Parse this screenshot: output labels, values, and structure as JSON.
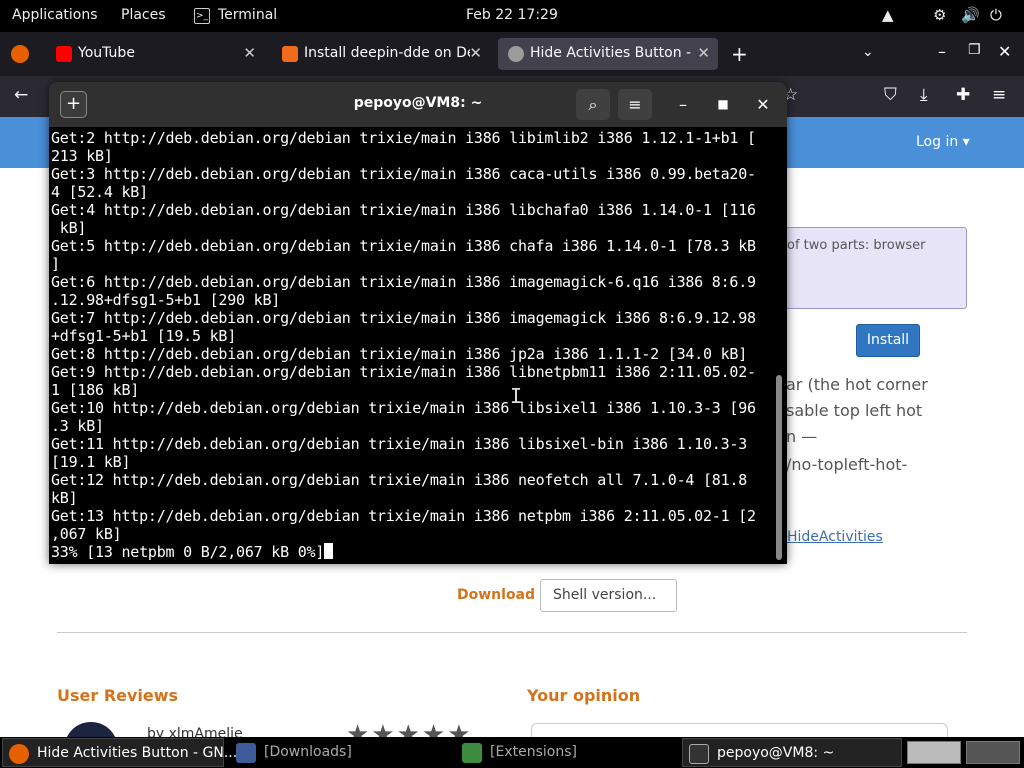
{
  "topbar": {
    "applications": "Applications",
    "places": "Places",
    "terminal": "Terminal",
    "clock": "Feb 22  17:29",
    "tray_icons": [
      "notification-icon",
      "network-icon",
      "volume-icon",
      "power-icon"
    ]
  },
  "browser": {
    "tabs": [
      {
        "label": "YouTube",
        "icon": "youtube-icon",
        "color": "#ff0000"
      },
      {
        "label": "Install deepin-dde on Deb",
        "icon": "ask-icon",
        "color": "#f26b1d"
      },
      {
        "label": "Hide Activities Button - G",
        "icon": "extension-icon",
        "color": "#9b9b9b"
      }
    ],
    "new_tab": "+"
  },
  "page": {
    "login": "Log in ▾",
    "notice": "of two parts: browser",
    "install": "Install",
    "desc_lines": [
      "ar (the hot corner",
      "sable top left hot",
      "n —",
      "/no-topleft-hot-"
    ],
    "ext_link": "HideActivities",
    "download": "Download",
    "shell_select": "Shell version...",
    "reviews_heading": "User Reviews",
    "opinion_heading": "Your opinion",
    "review_by": "by xlmAmelie",
    "stars": "★★★★★"
  },
  "terminal": {
    "title": "pepoyo@VM8: ~",
    "lines": [
      "Get:2 http://deb.debian.org/debian trixie/main i386 libimlib2 i386 1.12.1-1+b1 [",
      "213 kB]",
      "Get:3 http://deb.debian.org/debian trixie/main i386 caca-utils i386 0.99.beta20-",
      "4 [52.4 kB]",
      "Get:4 http://deb.debian.org/debian trixie/main i386 libchafa0 i386 1.14.0-1 [116",
      " kB]",
      "Get:5 http://deb.debian.org/debian trixie/main i386 chafa i386 1.14.0-1 [78.3 kB",
      "]",
      "Get:6 http://deb.debian.org/debian trixie/main i386 imagemagick-6.q16 i386 8:6.9",
      ".12.98+dfsg1-5+b1 [290 kB]",
      "Get:7 http://deb.debian.org/debian trixie/main i386 imagemagick i386 8:6.9.12.98",
      "+dfsg1-5+b1 [19.5 kB]",
      "Get:8 http://deb.debian.org/debian trixie/main i386 jp2a i386 1.1.1-2 [34.0 kB]",
      "Get:9 http://deb.debian.org/debian trixie/main i386 libnetpbm11 i386 2:11.05.02-",
      "1 [186 kB]",
      "Get:10 http://deb.debian.org/debian trixie/main i386 libsixel1 i386 1.10.3-3 [96",
      ".3 kB]",
      "Get:11 http://deb.debian.org/debian trixie/main i386 libsixel-bin i386 1.10.3-3",
      "[19.1 kB]",
      "Get:12 http://deb.debian.org/debian trixie/main i386 neofetch all 7.1.0-4 [81.8",
      "kB]",
      "Get:13 http://deb.debian.org/debian trixie/main i386 netpbm i386 2:11.05.02-1 [2",
      ",067 kB]"
    ],
    "progress_line": "33% [13 netpbm 0 B/2,067 kB 0%]"
  },
  "taskbar": [
    {
      "label": "Hide Activities Button - GN...",
      "icon": "firefox-icon"
    },
    {
      "label": "[Downloads]",
      "icon": "files-icon"
    },
    {
      "label": "[Extensions]",
      "icon": "extensions-icon"
    },
    {
      "label": "pepoyo@VM8: ~",
      "icon": "terminal-icon"
    }
  ],
  "colors": {
    "accent": "#4a90d9",
    "orange": "#d5731a",
    "terminal_bg": "#000000"
  }
}
